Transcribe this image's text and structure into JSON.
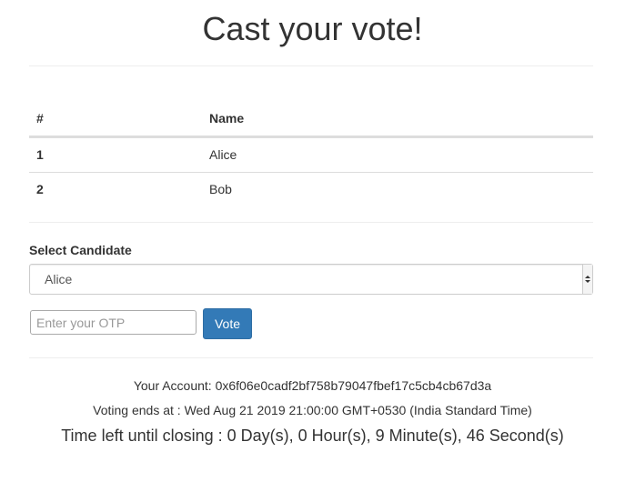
{
  "header": {
    "title": "Cast your vote!"
  },
  "candidates_table": {
    "columns": [
      "#",
      "Name"
    ],
    "rows": [
      {
        "id": "1",
        "name": "Alice"
      },
      {
        "id": "2",
        "name": "Bob"
      }
    ]
  },
  "form": {
    "select_label": "Select Candidate",
    "selected_candidate": "Alice",
    "otp_placeholder": "Enter your OTP",
    "vote_label": "Vote"
  },
  "footer": {
    "account_text": "Your Account: 0x6f06e0cadf2bf758b79047fbef17c5cb4cb67d3a",
    "voting_ends_text": "Voting ends at : Wed Aug 21 2019 21:00:00 GMT+0530 (India Standard Time)",
    "time_left_text": "Time left until closing : 0 Day(s), 0 Hour(s), 9 Minute(s), 46 Second(s)"
  },
  "colors": {
    "primary_button": "#337ab7",
    "text": "#333333"
  }
}
